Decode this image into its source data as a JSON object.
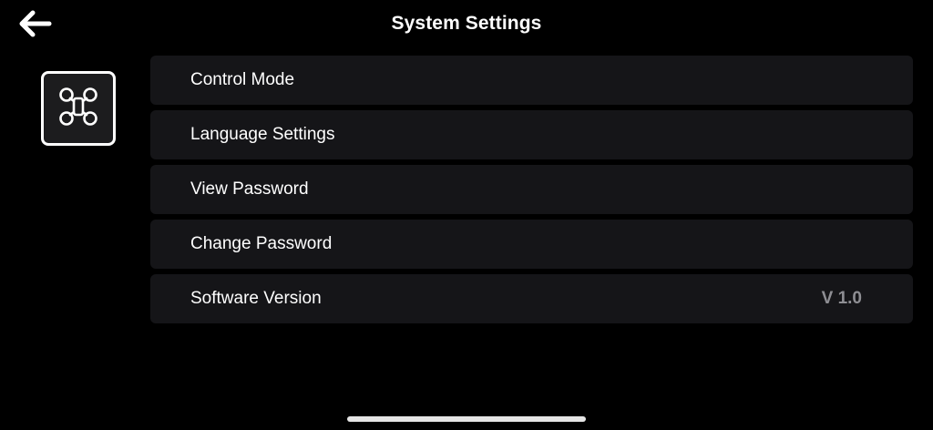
{
  "header": {
    "title": "System Settings",
    "back_icon": "arrow-left-icon"
  },
  "sidebar": {
    "device_icon": "drone-icon",
    "selected": true
  },
  "settings": {
    "items": [
      {
        "label": "Control Mode",
        "value": ""
      },
      {
        "label": "Language Settings",
        "value": ""
      },
      {
        "label": "View Password",
        "value": ""
      },
      {
        "label": "Change Password",
        "value": ""
      },
      {
        "label": "Software Version",
        "value": "V 1.0"
      }
    ]
  },
  "colors": {
    "background": "#000000",
    "row_background": "#151518",
    "text": "#ffffff",
    "secondary_text": "#8e8e93",
    "tile_border": "#ffffff"
  }
}
